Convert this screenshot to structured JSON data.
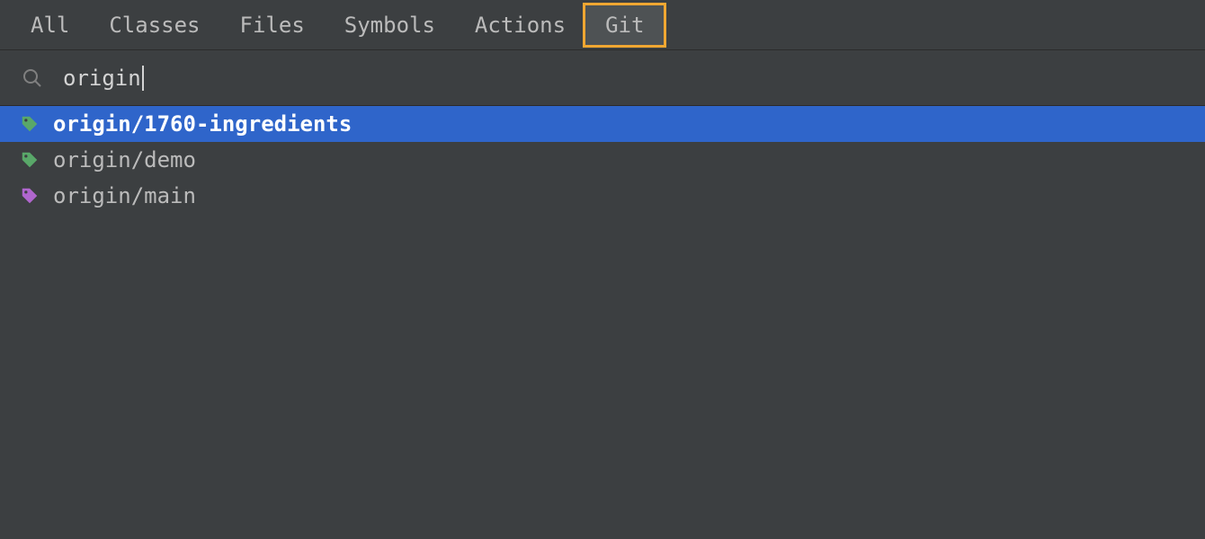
{
  "tabs": [
    {
      "label": "All",
      "active": false
    },
    {
      "label": "Classes",
      "active": false
    },
    {
      "label": "Files",
      "active": false
    },
    {
      "label": "Symbols",
      "active": false
    },
    {
      "label": "Actions",
      "active": false
    },
    {
      "label": "Git",
      "active": true
    }
  ],
  "search": {
    "value": "origin"
  },
  "results": [
    {
      "label": "origin/1760-ingredients",
      "selected": true,
      "icon_color": "#59A869"
    },
    {
      "label": "origin/demo",
      "selected": false,
      "icon_color": "#59A869"
    },
    {
      "label": "origin/main",
      "selected": false,
      "icon_color": "#B066CE"
    }
  ]
}
